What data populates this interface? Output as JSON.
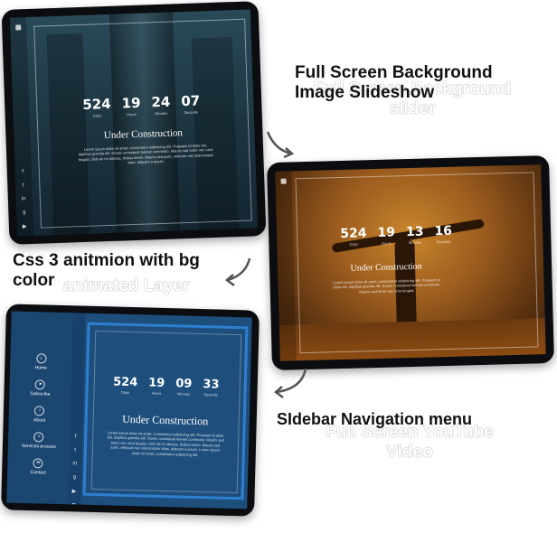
{
  "captions": {
    "slideshow": "Full Screen Background\nImage Slideshow",
    "slideshow_ghost": "Full Screen Background\nslider",
    "animation": "Css 3 anitmion with bg\ncolor",
    "animation_ghost": "animated Layer",
    "sidebar": "SIdebar Navigation menu",
    "sidebar_ghost": "Full Screen YouTube\nVideo"
  },
  "devices": [
    {
      "counters": [
        {
          "value": "524",
          "label": "Days"
        },
        {
          "value": "19",
          "label": "Hours"
        },
        {
          "value": "24",
          "label": "Minutes"
        },
        {
          "value": "07",
          "label": "Seconds"
        }
      ],
      "title": "Under Construction",
      "text": "Lorem ipsum dolor sit amet, consectetur adipiscing elit. Praesent id dolor dui, dapibus gravida elit. Donec consequat laoreet commodo. Mauris sed tortor nec urna feugiat. Sed vel mi ultrices, finibus lorem. Mauris sed justo, vehicula nec ullamcorper vitae, aliquam a ipsum."
    },
    {
      "counters": [
        {
          "value": "524",
          "label": "Days"
        },
        {
          "value": "19",
          "label": "Hours"
        },
        {
          "value": "13",
          "label": "Minutes"
        },
        {
          "value": "16",
          "label": "Seconds"
        }
      ],
      "title": "Under Construction",
      "text": "Lorem ipsum dolor sit amet, consectetur adipiscing elit. Praesent id dolor dui, dapibus gravida elit. Donec consequat laoreet commodo. Mauris sed tortor nec urna feugiat."
    },
    {
      "counters": [
        {
          "value": "524",
          "label": "Days"
        },
        {
          "value": "19",
          "label": "Hours"
        },
        {
          "value": "09",
          "label": "Minutes"
        },
        {
          "value": "33",
          "label": "Seconds"
        }
      ],
      "title": "Under Construction",
      "text": "Lorem ipsum dolor sit amet, consectetur adipiscing elit. Praesent id dolor dui, dapibus gravida elit. Donec consequat laoreet commodo. Mauris sed tortor nec urna feugiat. Sed vel mi ultrices, finibus lorem. Mauris sed justo, vehicula nec ullamcorper vitae, aliquam a ipsum. Lorem ipsum dolor sit amet, consectetur adipiscing elit.",
      "nav": [
        "Home",
        "Subscribe",
        "About",
        "Services process",
        "Contact"
      ]
    }
  ],
  "colors": {
    "dark_teal_bg": "#1d3642",
    "autumn_bg": "#7a4d1b",
    "blue_bg": "#1e4f7c",
    "blue_accent": "#2f7fd1"
  }
}
